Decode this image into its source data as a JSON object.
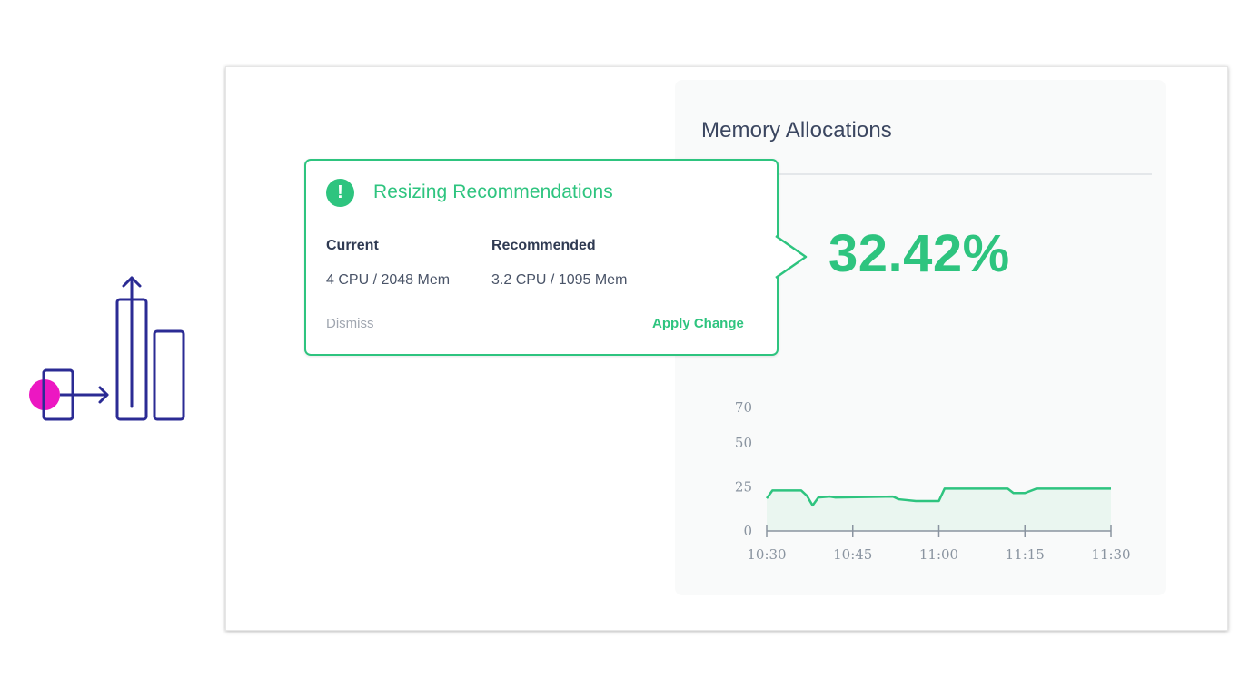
{
  "logo": {
    "icon": "resize-bars-icon",
    "stroke_color": "#2b2b94",
    "dot_color": "#ec17c2"
  },
  "panel": {
    "title": "Memory Allocations",
    "value": "32.42%"
  },
  "popover": {
    "icon": "exclamation-icon",
    "title": "Resizing Recommendations",
    "current_label": "Current",
    "current_value": "4 CPU / 2048 Mem",
    "recommended_label": "Recommended",
    "recommended_value": "3.2 CPU / 1095 Mem",
    "dismiss_label": "Dismiss",
    "apply_label": "Apply Change",
    "accent_color": "#2ec47f"
  },
  "chart_data": {
    "type": "area",
    "title": "",
    "xlabel": "",
    "ylabel": "",
    "x_ticks": [
      "10:30",
      "10:45",
      "11:00",
      "11:15",
      "11:30"
    ],
    "y_ticks": [
      0,
      25,
      50,
      70
    ],
    "xlim": [
      "10:30",
      "11:30"
    ],
    "series": [
      {
        "color": "#2ec47f",
        "points": [
          [
            "10:30",
            18.5
          ],
          [
            "10:31",
            23
          ],
          [
            "10:36",
            23
          ],
          [
            "10:37",
            20
          ],
          [
            "10:38",
            14.5
          ],
          [
            "10:39",
            19
          ],
          [
            "10:41",
            19.5
          ],
          [
            "10:42",
            19
          ],
          [
            "10:52",
            19.5
          ],
          [
            "10:53",
            18
          ],
          [
            "10:56",
            17
          ],
          [
            "10:59",
            17
          ],
          [
            "11:00",
            17
          ],
          [
            "11:01",
            24
          ],
          [
            "11:12",
            24
          ],
          [
            "11:13",
            21.5
          ],
          [
            "11:15",
            21.5
          ],
          [
            "11:17",
            24
          ],
          [
            "11:30",
            24
          ]
        ]
      }
    ]
  }
}
